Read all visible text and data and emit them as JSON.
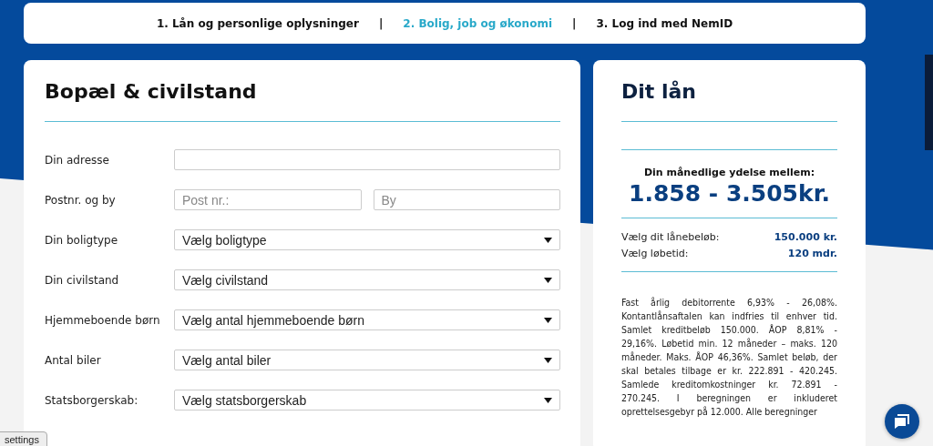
{
  "steps": [
    {
      "label": "1. Lån og personlige oplysninger",
      "selected": false
    },
    {
      "label": "2. Bolig, job og økonomi",
      "selected": true
    },
    {
      "label": "3. Log ind med NemID",
      "selected": false
    }
  ],
  "step_separator": "|",
  "form": {
    "title": "Bopæl & civilstand",
    "rows": [
      {
        "label": "Din adresse",
        "fields": [
          {
            "kind": "text"
          }
        ]
      },
      {
        "label": "Postnr. og by",
        "fields": [
          {
            "kind": "text",
            "placeholder": "Post nr.:"
          },
          {
            "kind": "text",
            "placeholder": "By"
          }
        ]
      },
      {
        "label": "Din boligtype",
        "fields": [
          {
            "kind": "select",
            "value": "Vælg boligtype"
          }
        ]
      },
      {
        "label": "Din civilstand",
        "fields": [
          {
            "kind": "select",
            "value": "Vælg civilstand"
          }
        ]
      },
      {
        "label": "Hjemmeboende børn",
        "fields": [
          {
            "kind": "select",
            "value": "Vælg antal hjemmeboende børn"
          }
        ]
      },
      {
        "label": "Antal biler",
        "fields": [
          {
            "kind": "select",
            "value": "Vælg antal biler"
          }
        ]
      },
      {
        "label": "Statsborgerskab:",
        "fields": [
          {
            "kind": "select",
            "value": "Vælg statsborgerskab"
          }
        ]
      }
    ]
  },
  "loan": {
    "title": "Dit lån",
    "payment_label": "Din månedlige ydelse mellem:",
    "payment_range": "1.858 - 3.505kr.",
    "details": [
      {
        "label": "Vælg dit lånebeløb:",
        "value": "150.000 kr."
      },
      {
        "label": "Vælg løbetid:",
        "value": "120 mdr."
      }
    ],
    "terms": "Fast årlig debitorrente 6,93% - 26,08%. Kontantlånsaftalen kan indfries til enhver tid. Samlet kreditbeløb 150.000. ÅOP 8,81% - 29,16%. Løbetid min. 12 måneder – maks. 120 måneder. Maks. ÅOP 46,36%. Samlet beløb, der skal betales tilbage er kr. 222.891 - 420.245. Samlede kreditomkostninger kr. 72.891 - 270.245. I beregningen er inkluderet oprettelsesgebyr på 12.000. Alle beregninger"
  },
  "settings_button": "settings"
}
